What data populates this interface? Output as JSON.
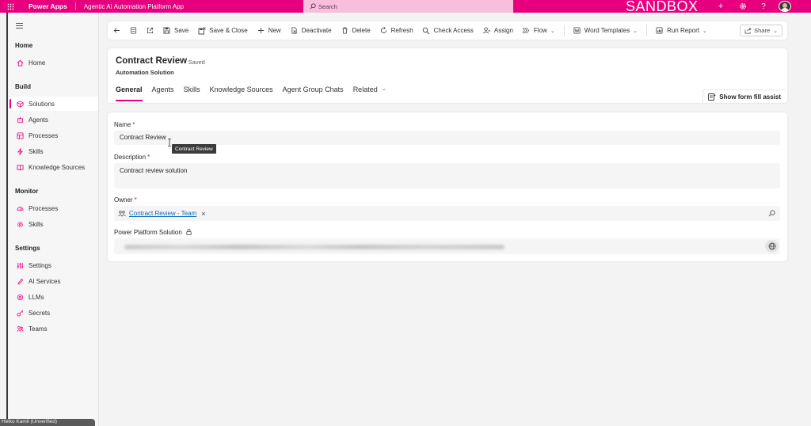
{
  "topbar": {
    "brand": "Power Apps",
    "app_name": "Agentic AI Automation Platform App",
    "search_placeholder": "Search",
    "environment_label": "SANDBOX",
    "accent": "#e6007e"
  },
  "sidebar": {
    "groups": [
      {
        "label": "Home",
        "items": [
          {
            "label": "Home",
            "icon": "home-icon"
          }
        ]
      },
      {
        "label": "Build",
        "items": [
          {
            "label": "Solutions",
            "icon": "solutions-icon",
            "active": true
          },
          {
            "label": "Agents",
            "icon": "agents-icon"
          },
          {
            "label": "Processes",
            "icon": "processes-icon"
          },
          {
            "label": "Skills",
            "icon": "skills-icon"
          },
          {
            "label": "Knowledge Sources",
            "icon": "book-icon"
          }
        ]
      },
      {
        "label": "Monitor",
        "items": [
          {
            "label": "Processes",
            "icon": "gauge-icon"
          },
          {
            "label": "Skills",
            "icon": "gear-icon"
          }
        ]
      },
      {
        "label": "Settings",
        "items": [
          {
            "label": "Settings",
            "icon": "sliders-icon"
          },
          {
            "label": "AI Services",
            "icon": "ai-icon"
          },
          {
            "label": "LLMs",
            "icon": "chip-icon"
          },
          {
            "label": "Secrets",
            "icon": "key-icon"
          },
          {
            "label": "Teams",
            "icon": "teams-icon"
          }
        ]
      }
    ],
    "footer_text": "Heiko Kamil (Unverified)"
  },
  "commandbar": {
    "items": [
      {
        "label": "Save",
        "icon": "save-icon"
      },
      {
        "label": "Save & Close",
        "icon": "save-close-icon"
      },
      {
        "label": "New",
        "icon": "plus-icon"
      },
      {
        "label": "Deactivate",
        "icon": "deactivate-icon"
      },
      {
        "label": "Delete",
        "icon": "trash-icon"
      },
      {
        "label": "Refresh",
        "icon": "refresh-icon"
      },
      {
        "label": "Check Access",
        "icon": "check-access-icon"
      },
      {
        "label": "Assign",
        "icon": "assign-icon"
      },
      {
        "label": "Flow",
        "icon": "flow-icon"
      },
      {
        "label": "Word Templates",
        "icon": "word-icon"
      },
      {
        "label": "Run Report",
        "icon": "report-icon"
      }
    ],
    "share_label": "Share"
  },
  "record": {
    "title": "Contract Review",
    "saved_status": "- Saved",
    "entity": "Automation Solution",
    "tabs": [
      "General",
      "Agents",
      "Skills",
      "Knowledge Sources",
      "Agent Group Chats",
      "Related"
    ],
    "active_tab": "General",
    "form_assist_label": "Show form fill assist"
  },
  "form": {
    "name_label": "Name",
    "name_value": "Contract Review",
    "name_tooltip": "Contract Review",
    "description_label": "Description",
    "description_value": "Contract review solution",
    "owner_label": "Owner",
    "owner_value": "Contract Review - Team",
    "power_platform_label": "Power Platform Solution"
  }
}
